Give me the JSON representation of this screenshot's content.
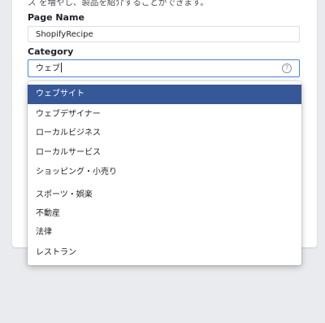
{
  "form": {
    "intro_text": "ス を増やし、製品を紹介することができます。",
    "page_name_label": "Page Name",
    "page_name_value": "ShopifyRecipe",
    "category_label": "Category",
    "category_value": "ウェブ",
    "help_icon": "question-circle-icon"
  },
  "dropdown": {
    "items": [
      {
        "label": "ウェブサイト",
        "selected": true
      },
      {
        "label": "ウェブデザイナー",
        "selected": false
      },
      {
        "label": "ローカルビジネス",
        "selected": false
      },
      {
        "label": "ローカルサービス",
        "selected": false
      },
      {
        "label": "ショッピング・小売り",
        "selected": false
      },
      {
        "label": "スポーツ・娯楽",
        "selected": false
      },
      {
        "label": "不動産",
        "selected": false
      },
      {
        "label": "法律",
        "selected": false
      },
      {
        "label": "レストラン",
        "selected": false
      }
    ]
  },
  "colors": {
    "selected_bg": "#365899",
    "focus_border": "#4080ff",
    "page_bg": "#e9ebee"
  }
}
